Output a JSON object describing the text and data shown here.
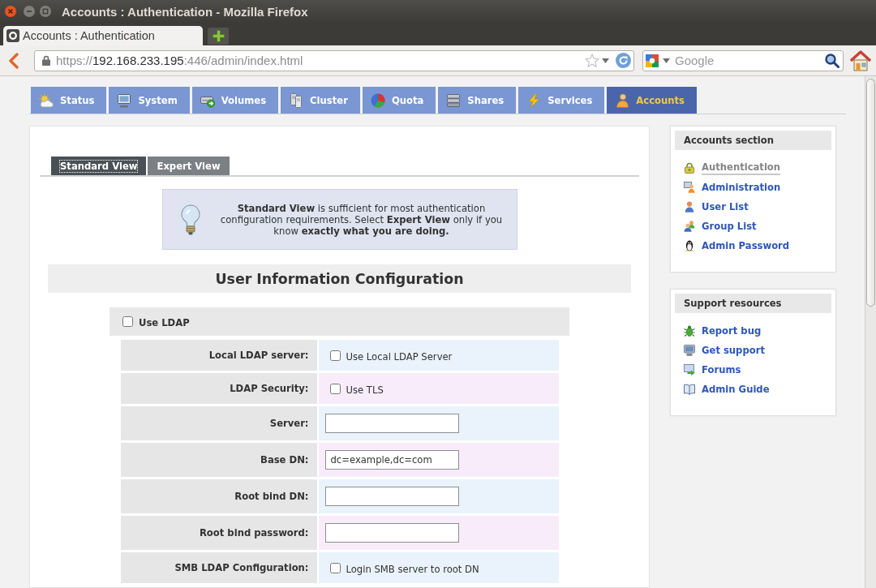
{
  "window": {
    "title": "Accounts : Authentication - Mozilla Firefox"
  },
  "browser_tabs": [
    {
      "label": "Accounts : Authentication",
      "selected": true
    }
  ],
  "address_bar": {
    "scheme": "https://",
    "host": "192.168.233.195",
    "path": ":446/admin/index.html"
  },
  "search": {
    "placeholder": "Google"
  },
  "nav_tabs": [
    {
      "label": "Status",
      "selected": false
    },
    {
      "label": "System",
      "selected": false
    },
    {
      "label": "Volumes",
      "selected": false
    },
    {
      "label": "Cluster",
      "selected": false
    },
    {
      "label": "Quota",
      "selected": false
    },
    {
      "label": "Shares",
      "selected": false
    },
    {
      "label": "Services",
      "selected": false
    },
    {
      "label": "Accounts",
      "selected": true
    }
  ],
  "view_tabs": [
    {
      "label": "Standard View",
      "selected": true
    },
    {
      "label": "Expert View",
      "selected": false
    }
  ],
  "info_note": "**Standard View** is sufficient for most authentication configuration requirements. Select **Expert View** only if you know **exactly what you are doing.**",
  "section_title": "User Information Configuration",
  "use_ldap": {
    "label": "Use LDAP",
    "checked": false
  },
  "form_rows": [
    {
      "label": "Local LDAP server:",
      "kind": "checkbox",
      "option": "Use Local LDAP Server",
      "checked": false
    },
    {
      "label": "LDAP Security:",
      "kind": "checkbox",
      "option": "Use TLS",
      "checked": false
    },
    {
      "label": "Server:",
      "kind": "text"
    },
    {
      "label": "Base DN:",
      "kind": "text",
      "value": "dc=example,dc=com"
    },
    {
      "label": "Root bind DN:",
      "kind": "text"
    },
    {
      "label": "Root bind password:",
      "kind": "password"
    },
    {
      "label": "SMB LDAP Configuration:",
      "kind": "checkbox",
      "option": "Login SMB server to root DN",
      "checked": false
    }
  ],
  "sidebar_boxes": [
    {
      "title": "Accounts section",
      "links": [
        {
          "label": "Authentication",
          "selected": true
        },
        {
          "label": "Administration",
          "selected": false
        },
        {
          "label": "User List",
          "selected": false
        },
        {
          "label": "Group List",
          "selected": false
        },
        {
          "label": "Admin Password",
          "selected": false
        }
      ]
    },
    {
      "title": "Support resources",
      "links": [
        {
          "label": "Report bug",
          "selected": false
        },
        {
          "label": "Get support",
          "selected": false
        },
        {
          "label": "Forums",
          "selected": false
        },
        {
          "label": "Admin Guide",
          "selected": false
        }
      ]
    }
  ]
}
